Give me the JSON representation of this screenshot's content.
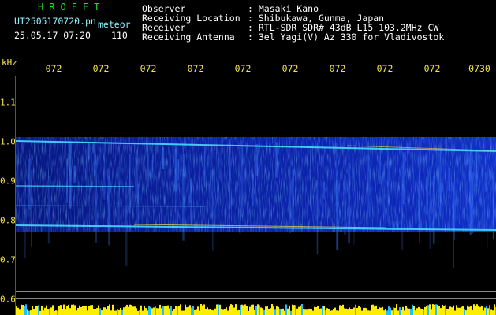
{
  "header": {
    "brand": "HROFFT",
    "file_name": "UT2505170720.pn",
    "mode": "meteor",
    "date_time": "25.05.17 07:20",
    "count": "110"
  },
  "station": {
    "observer_label": "Observer",
    "observer_value": ": Masaki Kano",
    "location_label": "Receiving Location",
    "location_value": ": Shibukawa, Gunma, Japan",
    "receiver_label": "Receiver",
    "receiver_value": ": RTL-SDR SDR# 43dB L15 103.2MHz CW",
    "antenna_label": "Receiving Antenna",
    "antenna_value": ": 3el Yagi(V) Az 330 for Vladivostok"
  },
  "axes": {
    "y_unit": "kHz",
    "time_ticks": [
      "072",
      "072",
      "072",
      "072",
      "072",
      "072",
      "072",
      "072",
      "072",
      "0730"
    ],
    "freq_ticks": [
      "1.1",
      "1.0",
      "0.9",
      "0.8",
      "0.7",
      "0.6"
    ]
  },
  "colors": {
    "background": "#000000",
    "band_bg": "#0a1a9a",
    "trace": "#44ddff",
    "hot": "#ffe040",
    "bar": "#ffee00"
  }
}
